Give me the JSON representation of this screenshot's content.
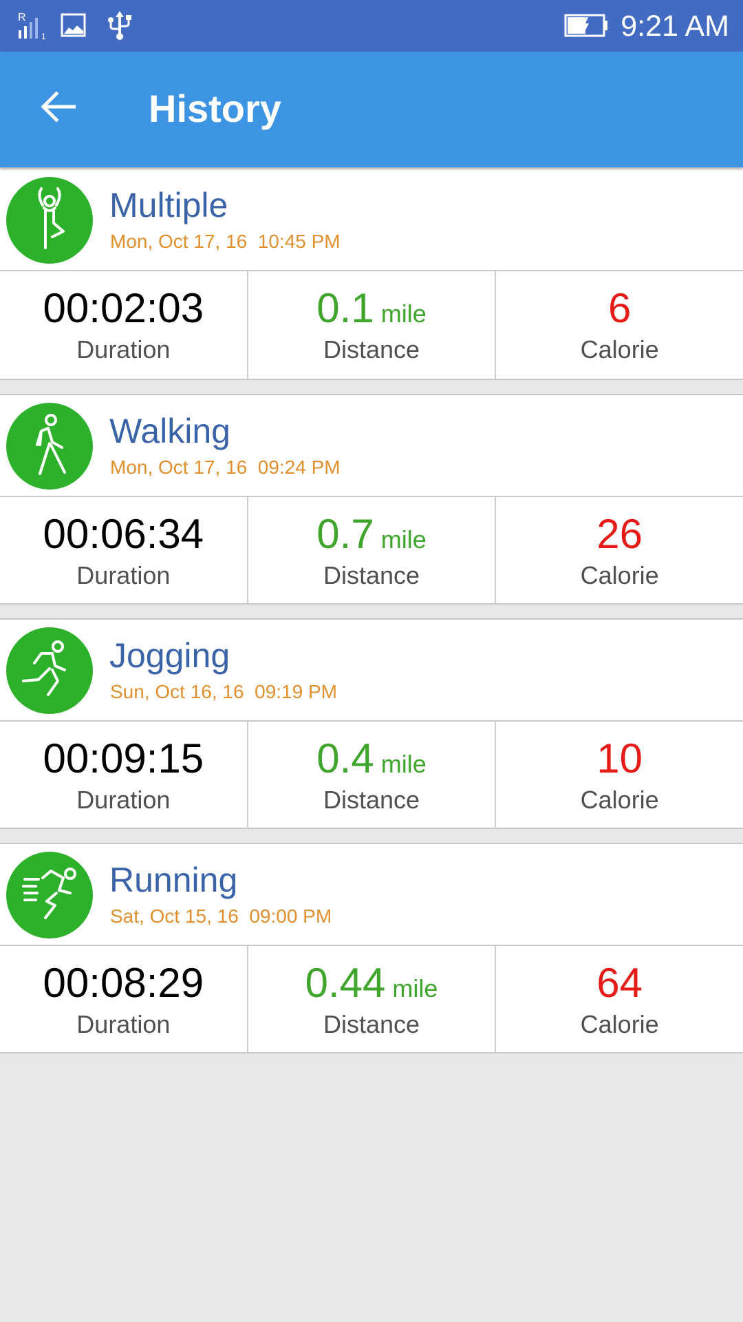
{
  "status_bar": {
    "icons": [
      "signal-roaming-icon",
      "image-notification-icon",
      "usb-icon",
      "battery-charging-icon"
    ],
    "signal_label": "R",
    "sim_slot": "1",
    "time": "9:21 AM"
  },
  "app_bar": {
    "back_icon": "arrow-left-icon",
    "title": "History"
  },
  "colors": {
    "status_bar": "#436bc2",
    "app_bar": "#3d94e2",
    "activity_icon_bg": "#2eb12a",
    "activity_name": "#3b63a8",
    "activity_date": "#e0902e",
    "distance": "#3fa52c",
    "calorie": "#e41b17"
  },
  "labels": {
    "duration": "Duration",
    "distance": "Distance",
    "calorie": "Calorie"
  },
  "activities": [
    {
      "icon": "yoga-pose-icon",
      "name": "Multiple",
      "date": "Mon, Oct 17, 16  10:45 PM",
      "duration": "00:02:03",
      "distance": "0.1",
      "distance_unit": "mile",
      "calorie": "6"
    },
    {
      "icon": "walking-icon",
      "name": "Walking",
      "date": "Mon, Oct 17, 16  09:24 PM",
      "duration": "00:06:34",
      "distance": "0.7",
      "distance_unit": "mile",
      "calorie": "26"
    },
    {
      "icon": "jogging-icon",
      "name": "Jogging",
      "date": "Sun, Oct 16, 16  09:19 PM",
      "duration": "00:09:15",
      "distance": "0.4",
      "distance_unit": "mile",
      "calorie": "10"
    },
    {
      "icon": "running-icon",
      "name": "Running",
      "date": "Sat, Oct 15, 16  09:00 PM",
      "duration": "00:08:29",
      "distance": "0.44",
      "distance_unit": "mile",
      "calorie": "64"
    }
  ]
}
